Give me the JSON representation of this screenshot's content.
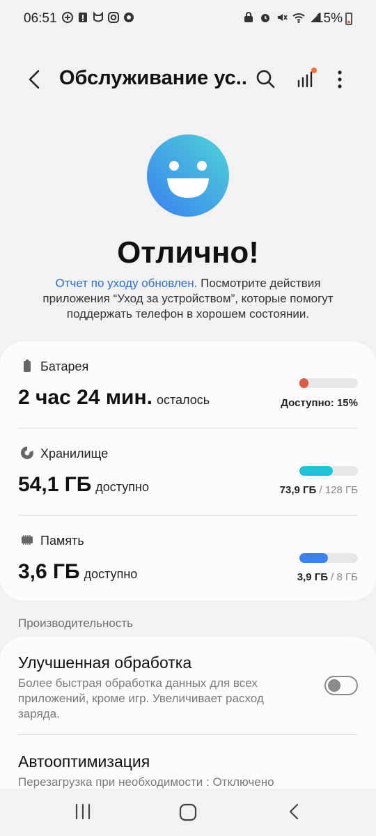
{
  "status_bar": {
    "time": "06:51",
    "battery_percent": "15%",
    "left_icons": [
      "plus-circle-icon",
      "alert-icon",
      "mi-icon",
      "instagram-icon",
      "chrome-icon"
    ],
    "right_icons": [
      "lock-clock-icon",
      "alarm-icon",
      "mute-icon",
      "wifi-icon",
      "signal-icon"
    ]
  },
  "app_bar": {
    "title": "Обслуживание ус...",
    "has_notification_dot": true
  },
  "hero": {
    "headline": "Отлично!",
    "link_text": "Отчет по уходу обновлен.",
    "body_text": " Посмотрите действия приложения “Уход за устройством”, которые помогут поддержать телефон в хорошем состоянии."
  },
  "items": {
    "battery": {
      "title": "Батарея",
      "value": "2 час 24 мин.",
      "unit": "осталось",
      "right_text": "Доступно: 15%",
      "level": 0.15,
      "color": "#e05a4a"
    },
    "storage": {
      "title": "Хранилище",
      "value": "54,1 ГБ",
      "unit": "доступно",
      "used": "73,9 ГБ",
      "total": " / 128 ГБ",
      "level": 0.577,
      "color": "#22c3da"
    },
    "memory": {
      "title": "Память",
      "value": "3,6 ГБ",
      "unit": "доступно",
      "used": "3,9 ГБ",
      "total": " / 8 ГБ",
      "level": 0.488,
      "color": "#3d82f0"
    }
  },
  "performance": {
    "section_label": "Производительность",
    "enhanced": {
      "title": "Улучшенная обработка",
      "description": "Более быстрая обработка данных для всех приложений, кроме игр. Увеличивает расход заряда.",
      "enabled": false
    },
    "auto_opt": {
      "title": "Автооптимизация",
      "description": "Перезагрузка при необходимости : Отключено"
    }
  },
  "colors": {
    "accent_link": "#2f6fd2",
    "smiley_gradient": [
      "#3a86f0",
      "#4fd0d8"
    ]
  }
}
